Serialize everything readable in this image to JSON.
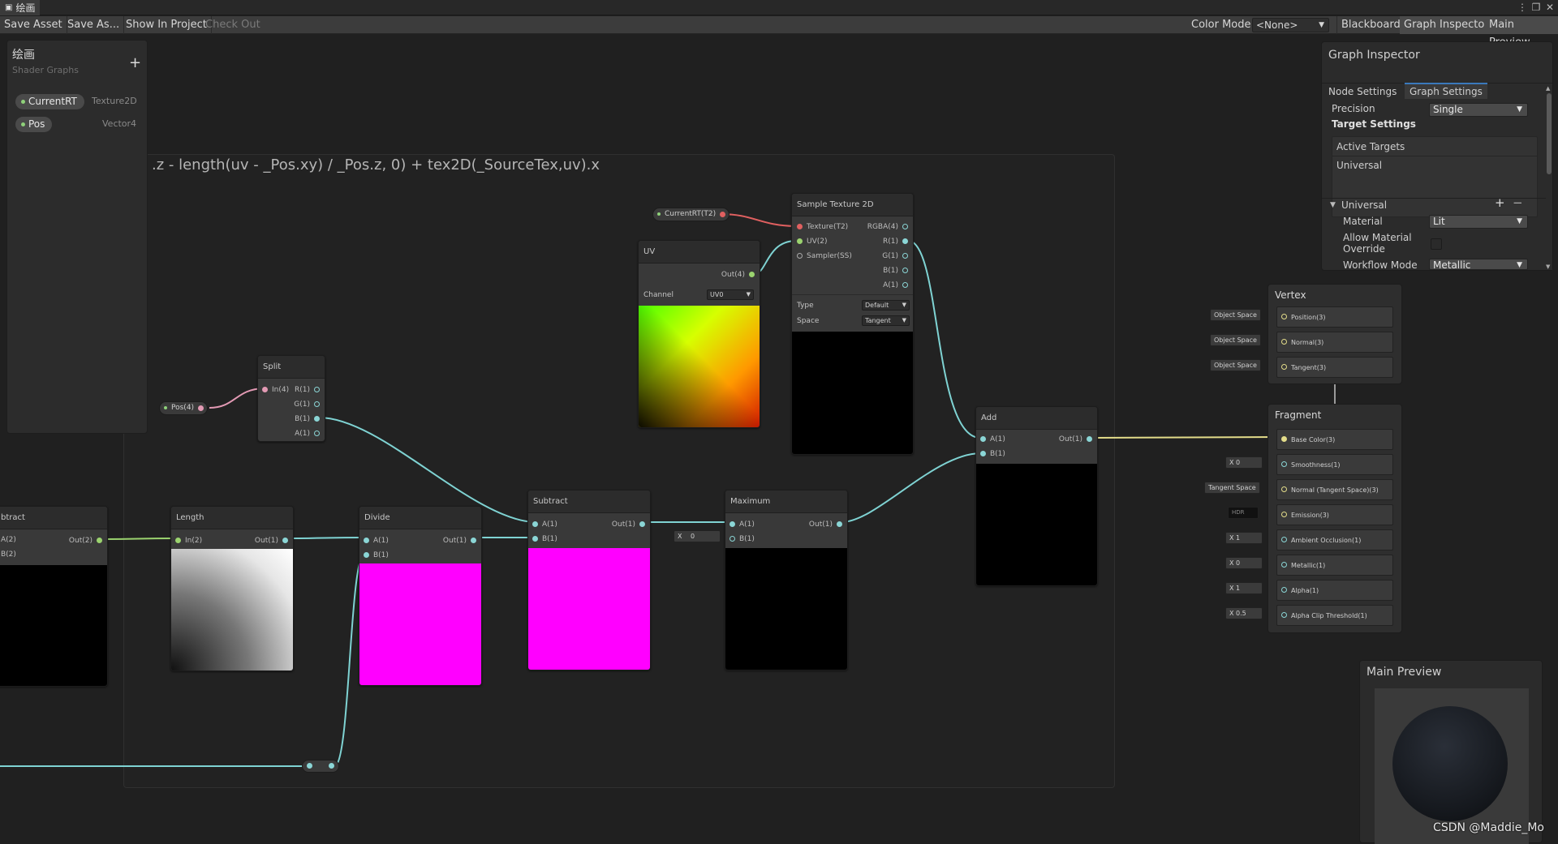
{
  "window": {
    "title": "绘画"
  },
  "toolbar": {
    "save_asset": "Save Asset",
    "save_as": "Save As...",
    "show_in_project": "Show In Project",
    "check_out": "Check Out",
    "color_mode_label": "Color Mode",
    "color_mode_value": "<None>",
    "blackboard": "Blackboard",
    "graph_inspector": "Graph Inspector",
    "main_preview": "Main Preview"
  },
  "blackboard": {
    "title": "绘画",
    "subtitle": "Shader Graphs",
    "add_glyph": "+",
    "properties": [
      {
        "name": "CurrentRT",
        "type": "Texture2D"
      },
      {
        "name": "Pos",
        "type": "Vector4"
      }
    ]
  },
  "group": {
    "title": ".z - length(uv - _Pos.xy) / _Pos.z, 0) + tex2D(_SourceTex,uv).x"
  },
  "property_nodes": {
    "current_rt": "CurrentRT(T2)",
    "pos": "Pos(4)"
  },
  "nodes": {
    "sample_texture": {
      "title": "Sample Texture 2D",
      "inputs": [
        "Texture(T2)",
        "UV(2)",
        "Sampler(SS)"
      ],
      "outputs": [
        "RGBA(4)",
        "R(1)",
        "G(1)",
        "B(1)",
        "A(1)"
      ],
      "type_label": "Type",
      "type_value": "Default",
      "space_label": "Space",
      "space_value": "Tangent"
    },
    "uv": {
      "title": "UV",
      "output": "Out(4)",
      "channel_label": "Channel",
      "channel_value": "UV0"
    },
    "split": {
      "title": "Split",
      "input": "In(4)",
      "outputs": [
        "R(1)",
        "G(1)",
        "B(1)",
        "A(1)"
      ]
    },
    "subtract_left": {
      "title": "btract",
      "inputs": [
        "A(2)",
        "B(2)"
      ],
      "output": "Out(2)"
    },
    "length": {
      "title": "Length",
      "input": "In(2)",
      "output": "Out(1)"
    },
    "divide": {
      "title": "Divide",
      "inputs": [
        "A(1)",
        "B(1)"
      ],
      "output": "Out(1)"
    },
    "subtract": {
      "title": "Subtract",
      "inputs": [
        "A(1)",
        "B(1)"
      ],
      "output": "Out(1)"
    },
    "maximum": {
      "title": "Maximum",
      "inputs": [
        "A(1)",
        "B(1)"
      ],
      "output": "Out(1)",
      "inline_x": "X",
      "inline_value": "0"
    },
    "add": {
      "title": "Add",
      "inputs": [
        "A(1)",
        "B(1)"
      ],
      "output": "Out(1)"
    }
  },
  "vertex": {
    "title": "Vertex",
    "blocks": [
      {
        "label": "Position(3)",
        "ctl": "Object Space"
      },
      {
        "label": "Normal(3)",
        "ctl": "Object Space"
      },
      {
        "label": "Tangent(3)",
        "ctl": "Object Space"
      }
    ]
  },
  "fragment": {
    "title": "Fragment",
    "blocks": [
      {
        "label": "Base Color(3)",
        "ctl": ""
      },
      {
        "label": "Smoothness(1)",
        "ctl": "X  0"
      },
      {
        "label": "Normal (Tangent Space)(3)",
        "ctl": "Tangent Space"
      },
      {
        "label": "Emission(3)",
        "ctl": "HDR"
      },
      {
        "label": "Ambient Occlusion(1)",
        "ctl": "X  1"
      },
      {
        "label": "Metallic(1)",
        "ctl": "X  0"
      },
      {
        "label": "Alpha(1)",
        "ctl": "X  1"
      },
      {
        "label": "Alpha Clip Threshold(1)",
        "ctl": "X  0.5"
      }
    ]
  },
  "inspector": {
    "title": "Graph Inspector",
    "tab_node": "Node Settings",
    "tab_graph": "Graph Settings",
    "precision_label": "Precision",
    "precision_value": "Single",
    "target_settings": "Target Settings",
    "active_targets": "Active Targets",
    "universal_item": "Universal",
    "plus": "+",
    "minus": "−",
    "universal_section": "Universal",
    "material_label": "Material",
    "material_value": "Lit",
    "allow_override_1": "Allow Material",
    "allow_override_2": "Override",
    "workflow_label": "Workflow Mode",
    "workflow_value": "Metallic"
  },
  "main_preview": {
    "title": "Main Preview"
  },
  "watermark": "CSDN @Maddie_Mo",
  "colors": {
    "edge_float": "#7fd3d3",
    "edge_vec4": "#e39ab4",
    "edge_texture": "#e06060",
    "edge_vec3": "#e3dc8a",
    "edge_vec2": "#9bd36f",
    "preview_magenta": "#ff00ff"
  }
}
